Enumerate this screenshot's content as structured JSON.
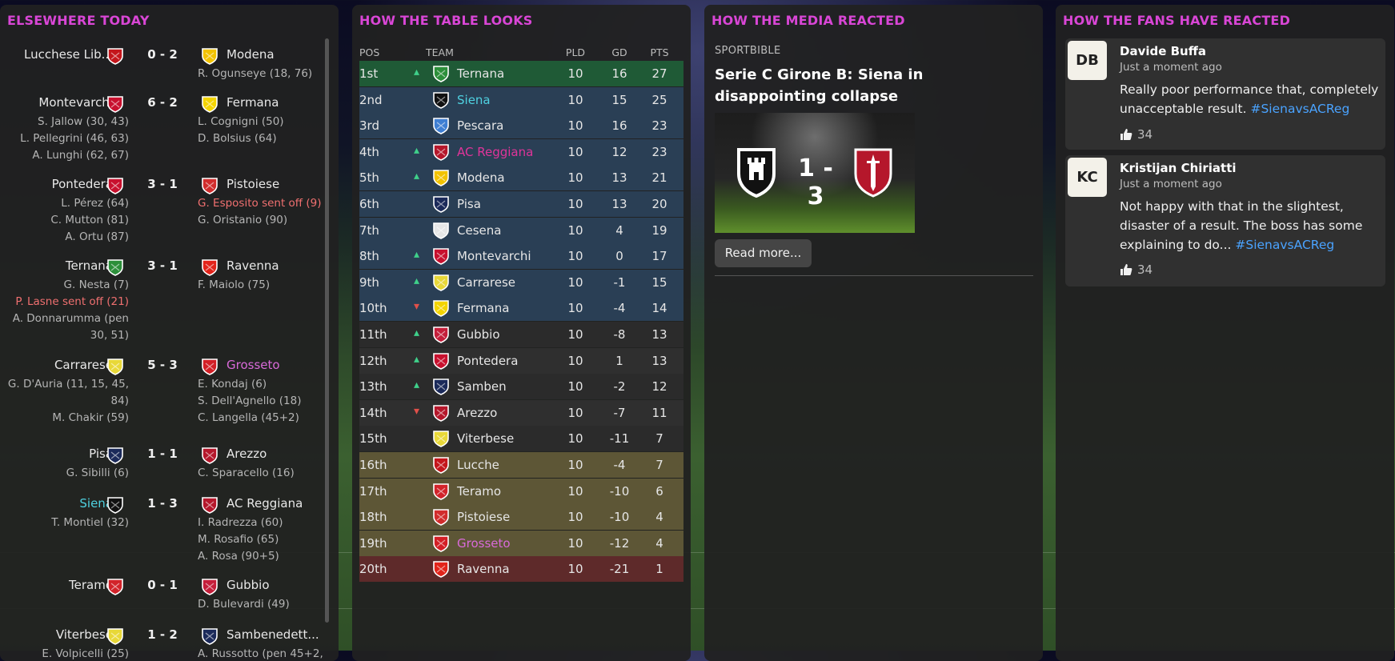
{
  "elsewhere": {
    "title": "ELSEWHERE TODAY",
    "results": [
      {
        "home": "Lucchese Lib...",
        "home_icon": "crest-lucchese-icon",
        "score": "0 - 2",
        "away": "Modena",
        "away_icon": "crest-modena-icon",
        "home_scorers": [],
        "away_scorers": [
          "R. Ogunseye (18, 76)"
        ]
      },
      {
        "home": "Montevarchi",
        "home_icon": "crest-montevarchi-icon",
        "score": "6 - 2",
        "away": "Fermana",
        "away_icon": "crest-fermana-icon",
        "home_scorers": [
          "S. Jallow (30, 43)",
          "L. Pellegrini (46, 63)",
          "A. Lunghi (62, 67)"
        ],
        "away_scorers": [
          "L. Cognigni (50)",
          "D. Bolsius (64)"
        ]
      },
      {
        "home": "Pontedera",
        "home_icon": "crest-pontedera-icon",
        "score": "3 - 1",
        "away": "Pistoiese",
        "away_icon": "crest-pistoiese-icon",
        "home_scorers": [
          "L. Pérez (64)",
          "C. Mutton (81)",
          "A. Ortu (87)"
        ],
        "away_scorers": [
          "G. Esposito sent off (9)",
          "G. Oristanio (90)"
        ]
      },
      {
        "home": "Ternana",
        "home_icon": "crest-ternana-icon",
        "score": "3 - 1",
        "away": "Ravenna",
        "away_icon": "crest-ravenna-icon",
        "home_scorers": [
          "G. Nesta (7)",
          "P. Lasne sent off (21)",
          "A. Donnarumma (pen",
          "30, 51)"
        ],
        "away_scorers": [
          "F. Maiolo (75)"
        ]
      },
      {
        "home": "Carrarese",
        "home_icon": "crest-carrarese-icon",
        "score": "5 - 3",
        "away": "Grosseto",
        "away_icon": "crest-grosseto-icon",
        "home_scorers": [
          "G. D'Auria (11, 15, 45,",
          "84)",
          "M. Chakir (59)"
        ],
        "away_scorers": [
          "E. Kondaj (6)",
          "S. Dell'Agnello (18)",
          "C. Langella (45+2)"
        ]
      },
      {
        "home": "Pisa",
        "home_icon": "crest-pisa-icon",
        "score": "1 - 1",
        "away": "Arezzo",
        "away_icon": "crest-arezzo-icon",
        "home_scorers": [
          "G. Sibilli (6)"
        ],
        "away_scorers": [
          "C. Sparacello (16)"
        ]
      },
      {
        "home": "Siena",
        "home_icon": "crest-siena-icon",
        "score": "1 - 3",
        "away": "AC Reggiana",
        "away_icon": "crest-reggiana-icon",
        "home_scorers": [
          "T. Montiel (32)"
        ],
        "away_scorers": [
          "I. Radrezza (60)",
          "M. Rosafio (65)",
          "A. Rosa (90+5)"
        ]
      },
      {
        "home": "Teramo",
        "home_icon": "crest-teramo-icon",
        "score": "0 - 1",
        "away": "Gubbio",
        "away_icon": "crest-gubbio-icon",
        "home_scorers": [],
        "away_scorers": [
          "D. Bulevardi (49)"
        ]
      },
      {
        "home": "Viterbese",
        "home_icon": "crest-viterbese-icon",
        "score": "1 - 2",
        "away": "Sambenedett...",
        "away_icon": "crest-sambenedettese-icon",
        "home_scorers": [
          "E. Volpicelli (25)"
        ],
        "away_scorers": [
          "A. Russotto (pen 45+2,"
        ]
      }
    ],
    "colors": {
      "user_team": "#4fd1e0",
      "rival_team": "#d96ad9",
      "red_card": "#f07070"
    }
  },
  "table": {
    "title": "HOW THE TABLE LOOKS",
    "headers": {
      "pos": "POS",
      "team": "TEAM",
      "pld": "PLD",
      "gd": "GD",
      "pts": "PTS"
    },
    "rows": [
      {
        "pos": "1st",
        "move": "up",
        "team": "Ternana",
        "pld": "10",
        "gd": "16",
        "pts": "27"
      },
      {
        "pos": "2nd",
        "move": "",
        "team": "Siena",
        "pld": "10",
        "gd": "15",
        "pts": "25"
      },
      {
        "pos": "3rd",
        "move": "",
        "team": "Pescara",
        "pld": "10",
        "gd": "16",
        "pts": "23"
      },
      {
        "pos": "4th",
        "move": "up",
        "team": "AC Reggiana",
        "pld": "10",
        "gd": "12",
        "pts": "23"
      },
      {
        "pos": "5th",
        "move": "up",
        "team": "Modena",
        "pld": "10",
        "gd": "13",
        "pts": "21"
      },
      {
        "pos": "6th",
        "move": "",
        "team": "Pisa",
        "pld": "10",
        "gd": "13",
        "pts": "20"
      },
      {
        "pos": "7th",
        "move": "",
        "team": "Cesena",
        "pld": "10",
        "gd": "4",
        "pts": "19"
      },
      {
        "pos": "8th",
        "move": "up",
        "team": "Montevarchi",
        "pld": "10",
        "gd": "0",
        "pts": "17"
      },
      {
        "pos": "9th",
        "move": "up",
        "team": "Carrarese",
        "pld": "10",
        "gd": "-1",
        "pts": "15"
      },
      {
        "pos": "10th",
        "move": "down",
        "team": "Fermana",
        "pld": "10",
        "gd": "-4",
        "pts": "14"
      },
      {
        "pos": "11th",
        "move": "up",
        "team": "Gubbio",
        "pld": "10",
        "gd": "-8",
        "pts": "13"
      },
      {
        "pos": "12th",
        "move": "up",
        "team": "Pontedera",
        "pld": "10",
        "gd": "1",
        "pts": "13"
      },
      {
        "pos": "13th",
        "move": "up",
        "team": "Samben",
        "pld": "10",
        "gd": "-2",
        "pts": "12"
      },
      {
        "pos": "14th",
        "move": "down",
        "team": "Arezzo",
        "pld": "10",
        "gd": "-7",
        "pts": "11"
      },
      {
        "pos": "15th",
        "move": "",
        "team": "Viterbese",
        "pld": "10",
        "gd": "-11",
        "pts": "7"
      },
      {
        "pos": "16th",
        "move": "",
        "team": "Lucche",
        "pld": "10",
        "gd": "-4",
        "pts": "7"
      },
      {
        "pos": "17th",
        "move": "",
        "team": "Teramo",
        "pld": "10",
        "gd": "-10",
        "pts": "6"
      },
      {
        "pos": "18th",
        "move": "",
        "team": "Pistoiese",
        "pld": "10",
        "gd": "-10",
        "pts": "4"
      },
      {
        "pos": "19th",
        "move": "",
        "team": "Grosseto",
        "pld": "10",
        "gd": "-12",
        "pts": "4"
      },
      {
        "pos": "20th",
        "move": "",
        "team": "Ravenna",
        "pld": "10",
        "gd": "-21",
        "pts": "1"
      }
    ],
    "zone_colors": {
      "promotion": "#1f5a36",
      "playoff": "#2a3f55",
      "playout": "#5d5636",
      "relegation": "#5e2a2a",
      "neutral": "#2b2b2b",
      "move_up": "#3fd08a",
      "move_down": "#e0504a"
    }
  },
  "media": {
    "title": "HOW THE MEDIA REACTED",
    "source": "SPORTBIBLE",
    "headline": "Serie C Girone B: Siena in disappointing collapse",
    "thumb_score": "1 - 3",
    "read_more": "Read more..."
  },
  "fans": {
    "title": "HOW THE FANS HAVE REACTED",
    "posts": [
      {
        "initials": "DB",
        "name": "Davide Buffa",
        "time": "Just a moment ago",
        "text": "Really poor performance that, completely unacceptable result.",
        "hashtag": "#SienavsACReg",
        "likes": "34"
      },
      {
        "initials": "KC",
        "name": "Kristijan Chiriatti",
        "time": "Just a moment ago",
        "text": "Not happy with that in the slightest, disaster of a result. The boss has some explaining to do...",
        "hashtag": "#SienavsACReg",
        "likes": "34"
      }
    ]
  },
  "crest_colors": {
    "Lucchese Lib...": "#c4161c",
    "Lucche": "#c4161c",
    "Modena": "#f2c200",
    "Montevarchi": "#c8102e",
    "Fermana": "#f3d400",
    "Pontedera": "#c8102e",
    "Pistoiese": "#d12c2c",
    "Ternana": "#2c8f3a",
    "Ravenna": "#e2231a",
    "Carrarese": "#e8d838",
    "Grosseto": "#d31f26",
    "Pisa": "#1b2a5a",
    "Arezzo": "#b5172b",
    "Siena": "#111111",
    "AC Reggiana": "#b5172b",
    "Teramo": "#d2232a",
    "Gubbio": "#c41e3a",
    "Viterbese": "#e8d838",
    "Sambenedett...": "#1b2a5a",
    "Samben": "#1b2a5a",
    "Pescara": "#3f7fd3",
    "Cesena": "#e6e6e6"
  }
}
